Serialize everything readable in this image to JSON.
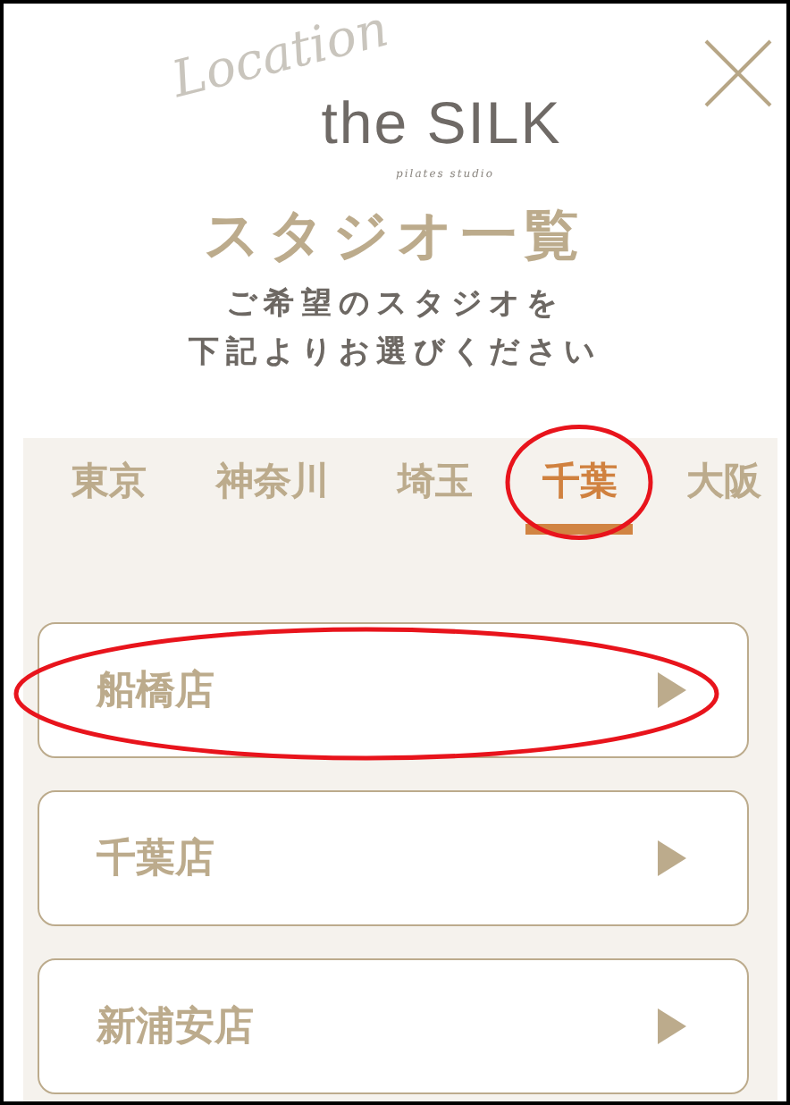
{
  "logo": {
    "script": "Location",
    "name": "the SILK",
    "tagline": "pilates studio"
  },
  "title": "スタジオ一覧",
  "subtitle": [
    "ご希望のスタジオを",
    "下記よりお選びください"
  ],
  "tabs": [
    {
      "label": "東京",
      "selected": false,
      "circled": false
    },
    {
      "label": "神奈川",
      "selected": false,
      "circled": false
    },
    {
      "label": "埼玉",
      "selected": false,
      "circled": false
    },
    {
      "label": "千葉",
      "selected": true,
      "circled": true
    },
    {
      "label": "大阪",
      "selected": false,
      "circled": false
    }
  ],
  "stores": [
    {
      "name": "船橋店",
      "circled": true
    },
    {
      "name": "千葉店",
      "circled": false
    },
    {
      "name": "新浦安店",
      "circled": false
    }
  ]
}
